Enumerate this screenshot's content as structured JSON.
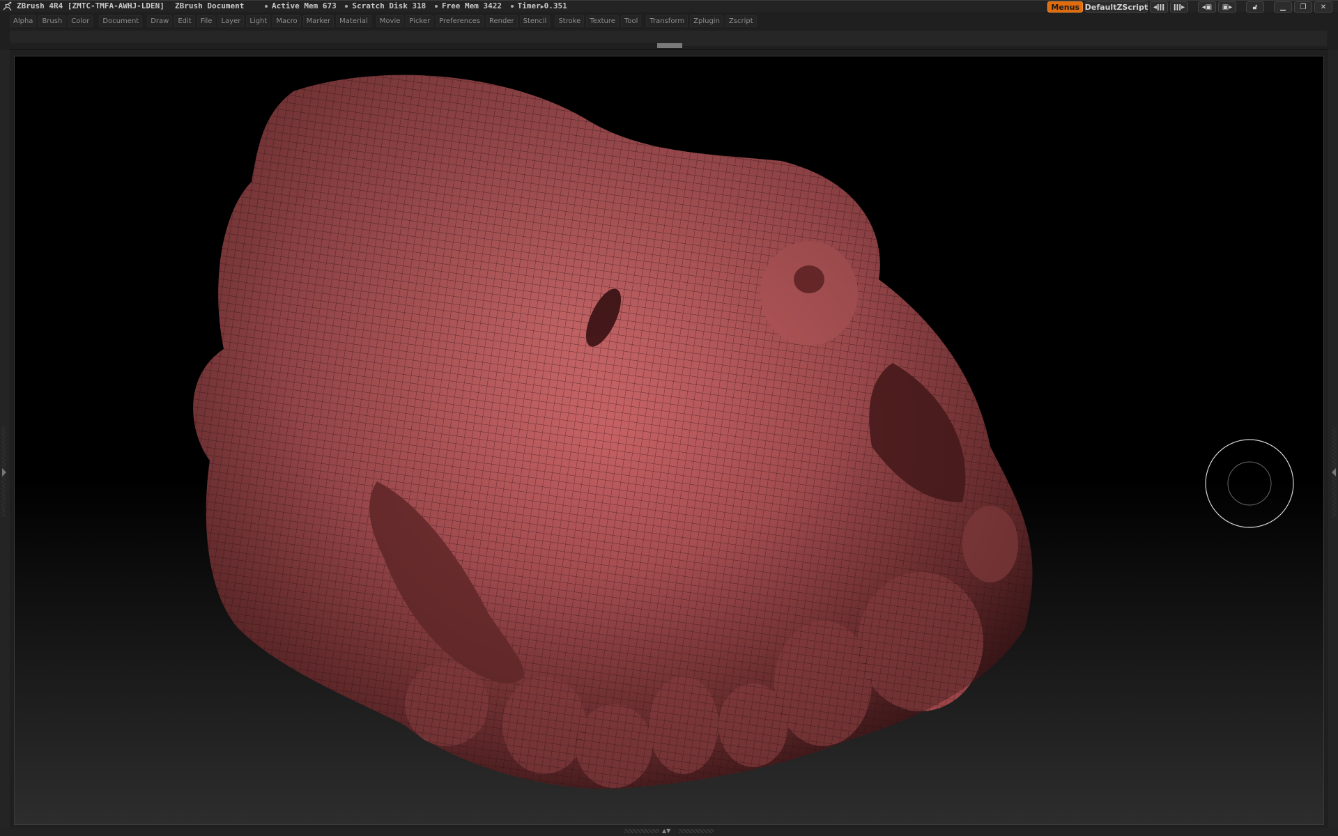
{
  "window": {
    "app_title": "ZBrush 4R4 [ZMTC-TMFA-AWHJ-LDEN]",
    "document_title": "ZBrush Document",
    "status": {
      "active_mem": "Active Mem 673",
      "scratch_disk": "Scratch Disk 318",
      "free_mem": "Free Mem 3422",
      "timer": "Timer",
      "timer_value": "0.351"
    }
  },
  "toolbar_right": {
    "menus_label": "Menus",
    "script_label": "DefaultZScript",
    "icons": [
      "decrease-width-icon",
      "increase-width-icon",
      "previous-layout-icon",
      "next-layout-icon",
      "lock-icon",
      "minimize-icon",
      "restore-icon",
      "close-icon"
    ]
  },
  "menubar": {
    "items": [
      "Alpha",
      "Brush",
      "Color",
      "Document",
      "Draw",
      "Edit",
      "File",
      "Layer",
      "Light",
      "Macro",
      "Marker",
      "Material",
      "Movie",
      "Picker",
      "Preferences",
      "Render",
      "Stencil",
      "Stroke",
      "Texture",
      "Tool",
      "Transform",
      "Zplugin",
      "Zscript"
    ]
  },
  "canvas": {
    "model_color": "#b8565a",
    "wire_color": "#3a1416",
    "background_top": "#000000",
    "background_bottom": "#2d2d2d",
    "brush_cursor_color": "#d8d8d8"
  }
}
